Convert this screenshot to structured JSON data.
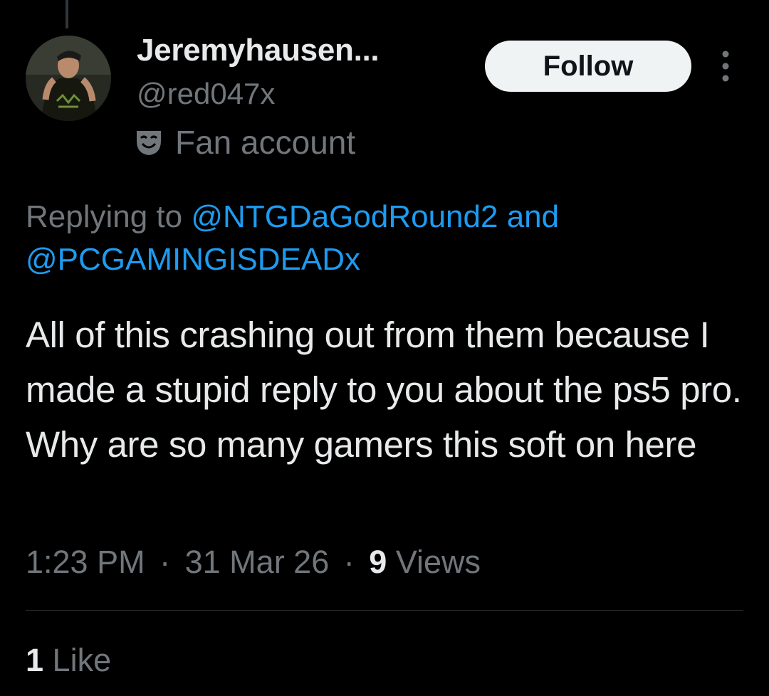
{
  "author": {
    "display_name": "Jeremyhausen...",
    "handle": "@red047x",
    "label": "Fan account",
    "label_icon": "theater-masks-icon"
  },
  "actions": {
    "follow_label": "Follow",
    "more_icon": "more-vertical-icon"
  },
  "reply_context": {
    "prefix": "Replying to",
    "mentions": [
      "@NTGDaGodRound2",
      "@PCGAMINGISDEADx"
    ],
    "joiner": "and"
  },
  "tweet": {
    "text": "All of this crashing out from them because I made a stupid reply to you about the ps5 pro. Why are so many gamers this soft on here"
  },
  "meta": {
    "time": "1:23 PM",
    "separator": "·",
    "date": "31 Mar 26",
    "views_count": "9",
    "views_label": "Views"
  },
  "stats": {
    "likes_count": "1",
    "likes_label": "Like"
  },
  "colors": {
    "background": "#000000",
    "primary_text": "#e7e9ea",
    "secondary_text": "#71767b",
    "link": "#1d9bf0",
    "follow_bg": "#eff3f4",
    "follow_text": "#0f1419"
  }
}
